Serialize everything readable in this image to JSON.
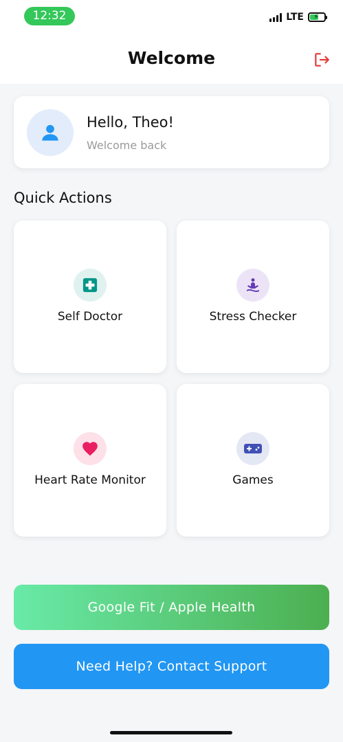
{
  "status_bar": {
    "time": "12:32",
    "network": "LTE"
  },
  "header": {
    "title": "Welcome",
    "logout_icon": "logout-icon"
  },
  "greeting": {
    "name": "Hello, Theo!",
    "subtitle": "Welcome back",
    "avatar_icon": "person-icon"
  },
  "quick_actions": {
    "title": "Quick Actions",
    "items": [
      {
        "label": "Self Doctor",
        "icon": "medical-cross-icon",
        "icon_bg": "#dff2ef",
        "icon_color": "#009688"
      },
      {
        "label": "Stress Checker",
        "icon": "meditation-icon",
        "icon_bg": "#ece4f6",
        "icon_color": "#673ab7"
      },
      {
        "label": "Heart Rate Monitor",
        "icon": "heart-icon",
        "icon_bg": "#fde0e8",
        "icon_color": "#e91e63"
      },
      {
        "label": "Games",
        "icon": "gamepad-icon",
        "icon_bg": "#e4e7f4",
        "icon_color": "#3f51b5"
      }
    ]
  },
  "buttons": {
    "health_sync": "Google Fit / Apple Health",
    "support": "Need Help? Contact Support"
  },
  "colors": {
    "accent_blue": "#2196f3",
    "green_start": "#69eaa8",
    "green_end": "#4caf50",
    "logout_red": "#e53935"
  }
}
